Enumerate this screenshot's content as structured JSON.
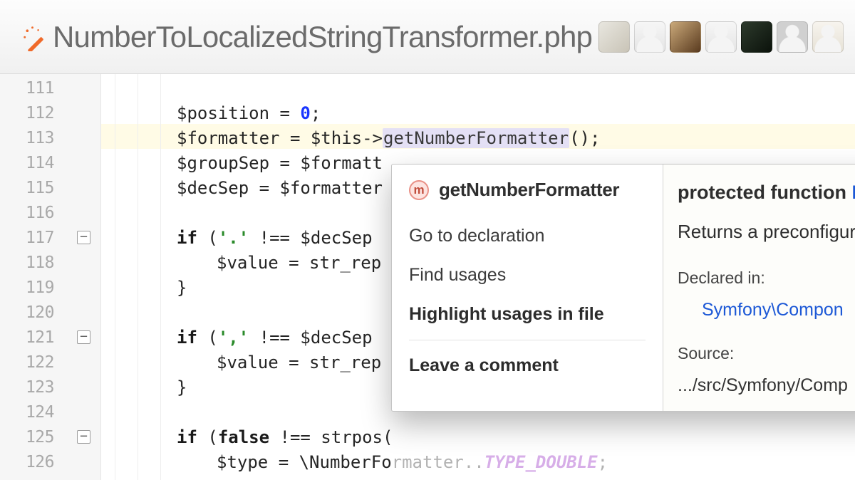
{
  "file_title": "NumberToLocalizedStringTransformer.php",
  "avatars": [
    "user-1",
    "user-2",
    "user-3",
    "user-4",
    "user-5",
    "user-6",
    "user-7"
  ],
  "gutter": {
    "lines": [
      "111",
      "112",
      "113",
      "114",
      "115",
      "116",
      "117",
      "118",
      "119",
      "120",
      "121",
      "122",
      "123",
      "124",
      "125",
      "126"
    ],
    "folds": [
      6,
      10,
      14
    ]
  },
  "code": {
    "l112_a": "$position = ",
    "l112_num": "0",
    "l112_b": ";",
    "l113_a": "$formatter = $this->",
    "l113_fn": "getNumberFormatter",
    "l113_b": "();",
    "l114": "$groupSep = $formatt",
    "l115": "$decSep = $formatter",
    "l117_a": "if",
    "l117_b": " (",
    "l117_str": "'.'",
    "l117_c": " !== $decSep ",
    "l118": "$value = str_rep",
    "l119": "}",
    "l121_a": "if",
    "l121_b": " (",
    "l121_str": "','",
    "l121_c": " !== $decSep ",
    "l122": "$value = str_rep",
    "l123": "}",
    "l125_a": "if",
    "l125_b": " (",
    "l125_c": "false",
    "l125_d": " !== strpos(",
    "l126_a": "$type = \\NumberFo",
    "l126_cut": "rmatter..",
    "l126_const": "TYPE_DOUBLE",
    "l126_b": ";"
  },
  "popup": {
    "icon_letter": "m",
    "title": "getNumberFormatter",
    "items": {
      "decl": "Go to declaration",
      "find": "Find usages",
      "highlight": "Highlight usages in file",
      "comment": "Leave a comment"
    },
    "sig_kw": "protected function",
    "sig_type": "N",
    "desc": "Returns a preconfigur",
    "declared_label": "Declared in:",
    "declared_link": "Symfony\\Compon",
    "source_label": "Source:",
    "source_path": ".../src/Symfony/Comp"
  }
}
